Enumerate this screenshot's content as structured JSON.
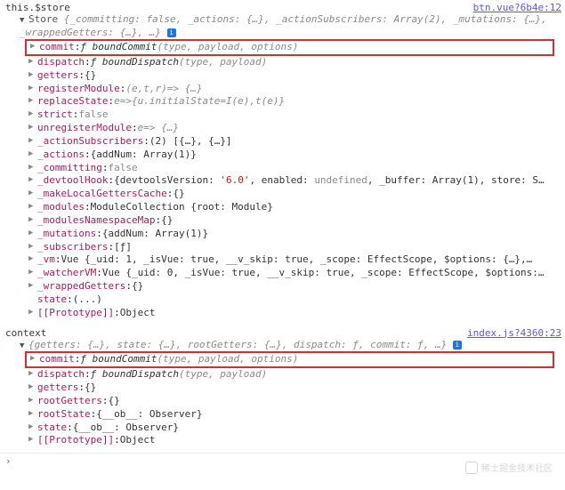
{
  "blocks": [
    {
      "expr": "this.$store",
      "loc": "btn.vue?6b4e:12",
      "summaryPrefix": "Store",
      "summary": " {_committing: false, _actions: {…}, _actionSubscribers: Array(2), _mutations: {…}, _wrappedGetters: {…}, …}",
      "hasInfo": true,
      "highlight": {
        "key": "commit",
        "val": "ƒ boundCommit",
        "sig": "(type, payload, options)"
      },
      "rows": [
        {
          "key": "dispatch",
          "fn": "ƒ boundDispatch",
          "sig": "(type, payload)"
        },
        {
          "key": "getters",
          "val": "{}"
        },
        {
          "key": "registerModule",
          "fn": "",
          "sig": "(e,t,r)=> {…}"
        },
        {
          "key": "replaceState",
          "fn": "",
          "sig": "e=>{u.initialState=I(e),t(e)}"
        },
        {
          "key": "strict",
          "kw": "false"
        },
        {
          "key": "unregisterModule",
          "fn": "",
          "sig": "e=> {…}"
        },
        {
          "key": "_actionSubscribers",
          "val": "(2) [{…}, {…}]"
        },
        {
          "key": "_actions",
          "val": "{addNum: Array(1)}"
        },
        {
          "key": "_committing",
          "kw": "false"
        },
        {
          "key": "_devtoolHook",
          "val": "{devtoolsVersion: '6.0', enabled: undefined, _buffer: Array(1), store: S…",
          "hasStr": true
        },
        {
          "key": "_makeLocalGettersCache",
          "val": "{}"
        },
        {
          "key": "_modules",
          "val": "ModuleCollection {root: Module}"
        },
        {
          "key": "_modulesNamespaceMap",
          "val": "{}"
        },
        {
          "key": "_mutations",
          "val": "{addNum: Array(1)}"
        },
        {
          "key": "_subscribers",
          "val": "[ƒ]"
        },
        {
          "key": "_vm",
          "val": "Vue {_uid: 1, _isVue: true, __v_skip: true, _scope: EffectScope, $options: {…},…"
        },
        {
          "key": "_watcherVM",
          "val": "Vue {_uid: 0, _isVue: true, __v_skip: true, _scope: EffectScope, $options:…"
        },
        {
          "key": "_wrappedGetters",
          "val": "{}"
        },
        {
          "key": "state",
          "val": "(...)",
          "noTw": true
        },
        {
          "key": "[[Prototype]]",
          "val": "Object"
        }
      ]
    },
    {
      "expr": "context",
      "loc": "index.js?4360:23",
      "summaryPrefix": "",
      "summary": "{getters: {…}, state: {…}, rootGetters: {…}, dispatch: ƒ, commit: ƒ, …}",
      "hasInfo": true,
      "highlight": {
        "key": "commit",
        "val": "ƒ boundCommit",
        "sig": "(type, payload, options)"
      },
      "rows": [
        {
          "key": "dispatch",
          "fn": "ƒ boundDispatch",
          "sig": "(type, payload)"
        },
        {
          "key": "getters",
          "val": "{}"
        },
        {
          "key": "rootGetters",
          "val": "{}"
        },
        {
          "key": "rootState",
          "val": "{__ob__: Observer}"
        },
        {
          "key": "state",
          "val": "{__ob__: Observer}"
        },
        {
          "key": "[[Prototype]]",
          "val": "Object"
        }
      ]
    }
  ],
  "watermark": "稀土掘金技术社区",
  "prompt": "›"
}
